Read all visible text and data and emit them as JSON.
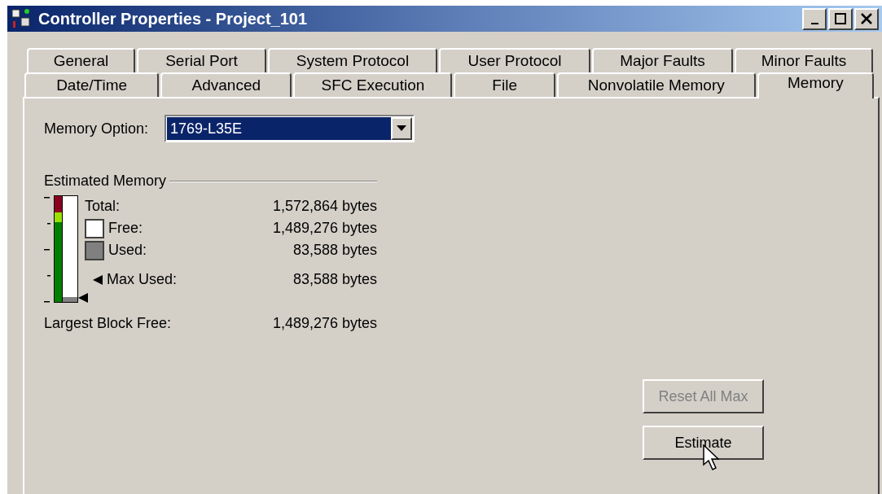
{
  "window": {
    "title": "Controller Properties - Project_101"
  },
  "tab_rows": [
    [
      {
        "label": "General",
        "selected": false
      },
      {
        "label": "Serial Port",
        "selected": false
      },
      {
        "label": "System Protocol",
        "selected": false
      },
      {
        "label": "User Protocol",
        "selected": false
      },
      {
        "label": "Major Faults",
        "selected": false
      },
      {
        "label": "Minor Faults",
        "selected": false
      }
    ],
    [
      {
        "label": "Date/Time",
        "selected": false
      },
      {
        "label": "Advanced",
        "selected": false
      },
      {
        "label": "SFC Execution",
        "selected": false
      },
      {
        "label": "File",
        "selected": false
      },
      {
        "label": "Nonvolatile Memory",
        "selected": false
      },
      {
        "label": "Memory",
        "selected": true
      }
    ]
  ],
  "memory_option": {
    "label": "Memory Option:",
    "value": "1769-L35E"
  },
  "estimated_memory": {
    "title": "Estimated Memory",
    "gauge": {
      "level": 0.05
    },
    "rows": [
      {
        "kind": "plain",
        "label": "Total:",
        "value": "1,572,864 bytes"
      },
      {
        "kind": "free",
        "label": "Free:",
        "value": "1,489,276 bytes"
      },
      {
        "kind": "used",
        "label": "Used:",
        "value": "83,588 bytes"
      },
      {
        "kind": "max",
        "label": "Max Used:",
        "value": "83,588 bytes"
      }
    ],
    "largest_block": {
      "label": "Largest Block Free:",
      "value": "1,489,276 bytes"
    }
  },
  "buttons": [
    {
      "label": "Reset All Max",
      "disabled": true
    },
    {
      "label": "Estimate",
      "disabled": false
    }
  ]
}
